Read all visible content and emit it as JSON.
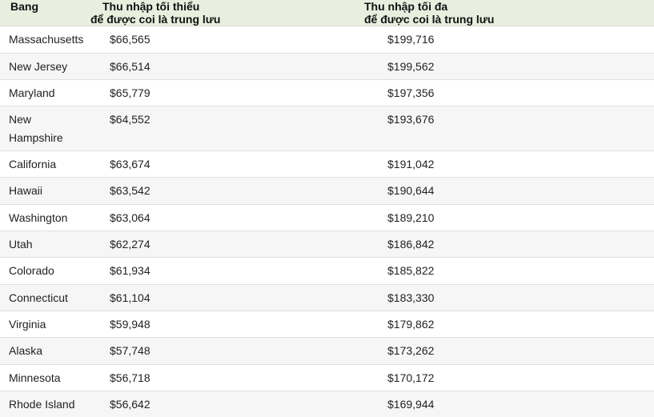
{
  "table": {
    "headers": {
      "state": "Bang",
      "min_line1": "Thu nhập tối thiểu",
      "min_line2": "để được coi là trung lưu",
      "max_line1": "Thu nhập tối đa",
      "max_line2": "để được coi là trung lưu"
    },
    "rows": [
      {
        "state": "Massachusetts",
        "min": "$66,565",
        "max": "$199,716"
      },
      {
        "state": "New Jersey",
        "min": "$66,514",
        "max": "$199,562"
      },
      {
        "state": "Maryland",
        "min": "$65,779",
        "max": "$197,356"
      },
      {
        "state": "New Hampshire",
        "min": "$64,552",
        "max": "$193,676"
      },
      {
        "state": "California",
        "min": "$63,674",
        "max": "$191,042"
      },
      {
        "state": "Hawaii",
        "min": "$63,542",
        "max": "$190,644"
      },
      {
        "state": "Washington",
        "min": "$63,064",
        "max": "$189,210"
      },
      {
        "state": "Utah",
        "min": "$62,274",
        "max": "$186,842"
      },
      {
        "state": "Colorado",
        "min": "$61,934",
        "max": "$185,822"
      },
      {
        "state": "Connecticut",
        "min": "$61,104",
        "max": "$183,330"
      },
      {
        "state": "Virginia",
        "min": "$59,948",
        "max": "$179,862"
      },
      {
        "state": "Alaska",
        "min": "$57,748",
        "max": "$173,262"
      },
      {
        "state": "Minnesota",
        "min": "$56,718",
        "max": "$170,172"
      },
      {
        "state": "Rhode Island",
        "min": "$56,642",
        "max": "$169,944"
      }
    ]
  }
}
